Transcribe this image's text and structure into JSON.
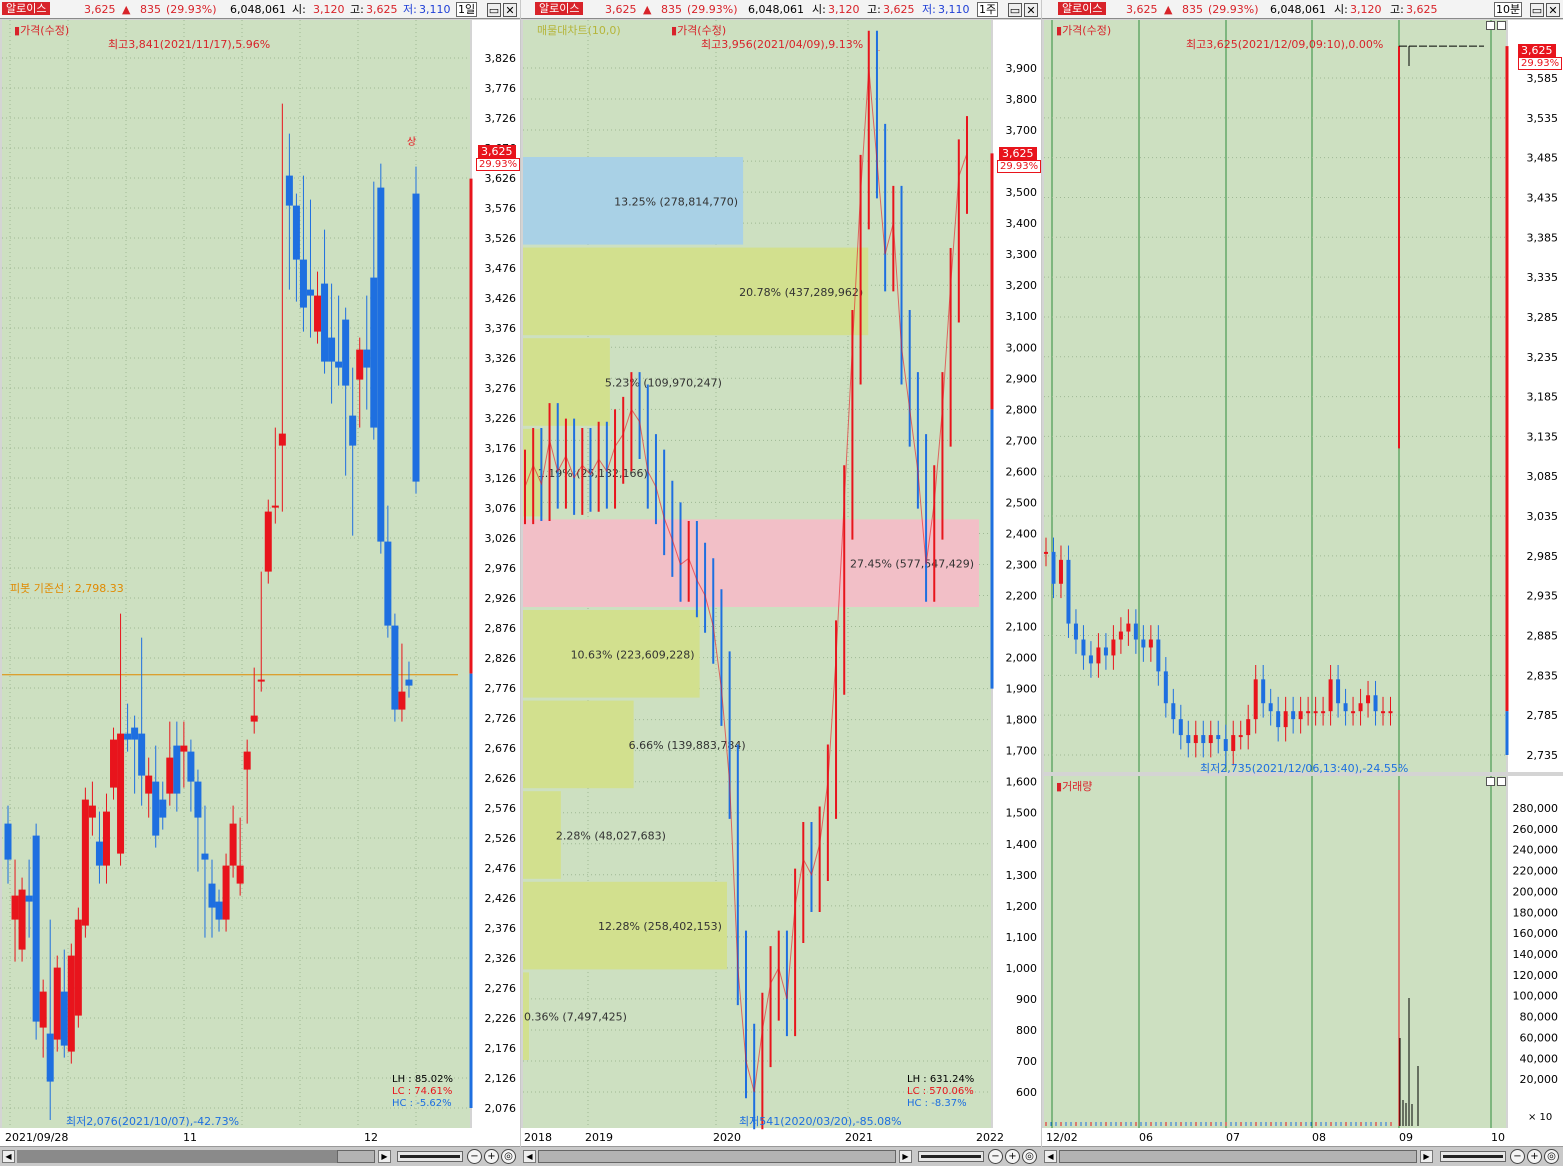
{
  "header": {
    "name": "알로이스",
    "price": "3,625",
    "change": "835",
    "pct": "(29.93%)",
    "volume": "6,048,061",
    "open_label": "시:",
    "open": "3,120",
    "high_label": "고:",
    "high": "3,625",
    "low_label": "저:",
    "low": "3,110"
  },
  "panels": {
    "daily": {
      "period": "1일",
      "legend": "가격(수정)",
      "high_annot": "최고3,841(2021/11/17),5.96%",
      "low_annot": "최저2,076(2021/10/07),-42.73%",
      "pivot": "피봇 기준선 : 2,798.33",
      "limit_up": "상",
      "price_tag": "3,625",
      "pct_tag": "29.93%",
      "lh": "LH : 85.02%",
      "lc": "LC : 74.61%",
      "hc": "HC : -5.62%",
      "x_labels": [
        "2021/09/28",
        "11",
        "12"
      ]
    },
    "weekly": {
      "period": "1주",
      "legend": "가격(수정)",
      "legend2": "매물대차트(10,0)",
      "high_annot": "최고3,956(2021/04/09),9.13%",
      "low_annot": "최저541(2020/03/20),-85.08%",
      "price_tag": "3,625",
      "pct_tag": "29.93%",
      "lh": "LH : 631.24%",
      "lc": "LC : 570.06%",
      "hc": "HC : -8.37%",
      "x_labels": [
        "2018",
        "2019",
        "2020",
        "2021",
        "2022"
      ]
    },
    "min10": {
      "period": "10분",
      "legend": "가격(수정)",
      "high_annot": "최고3,625(2021/12/09,09:10),0.00%",
      "low_annot": "최저2,735(2021/12/06,13:40),-24.55%",
      "price_tag": "3,625",
      "pct_tag": "29.93%",
      "vol_legend": "거래량",
      "vol_unit": "× 10",
      "x_labels": [
        "12/02",
        "06",
        "07",
        "08",
        "09",
        "10"
      ]
    }
  },
  "colors": {
    "up": "#e8141c",
    "down": "#1e6fe0",
    "plot_bg": "#cde0c1",
    "pivot": "#e08a00"
  },
  "chart_data": [
    {
      "type": "candlestick",
      "title": "가격(수정) 1일",
      "ylim": [
        2050,
        3900
      ],
      "y_ticks": [
        3826,
        3776,
        3726,
        3676,
        3626,
        3576,
        3526,
        3476,
        3426,
        3376,
        3326,
        3276,
        3226,
        3176,
        3126,
        3076,
        3026,
        2976,
        2926,
        2876,
        2826,
        2776,
        2726,
        2676,
        2626,
        2576,
        2526,
        2476,
        2426,
        2376,
        2326,
        2276,
        2226,
        2176,
        2126,
        2076
      ],
      "x_labels": [
        "2021/09/28",
        "11",
        "12"
      ],
      "ohlc": [
        [
          2550,
          2560,
          2470,
          2490
        ],
        [
          2390,
          2470,
          2340,
          2430
        ],
        [
          2340,
          2440,
          2340,
          2440
        ],
        [
          2430,
          2470,
          2380,
          2420
        ],
        [
          2530,
          2530,
          2210,
          2220
        ],
        [
          2210,
          2270,
          2180,
          2270
        ],
        [
          2200,
          2370,
          2076,
          2120
        ],
        [
          2190,
          2300,
          2190,
          2310
        ],
        [
          2270,
          2320,
          2180,
          2180
        ],
        [
          2170,
          2330,
          2170,
          2330
        ],
        [
          2230,
          2390,
          2230,
          2390
        ],
        [
          2380,
          2590,
          2380,
          2590
        ],
        [
          2560,
          2600,
          2550,
          2580
        ],
        [
          2520,
          2550,
          2470,
          2480
        ],
        [
          2480,
          2580,
          2470,
          2570
        ],
        [
          2610,
          2680,
          2610,
          2690
        ],
        [
          2500,
          2880,
          2500,
          2700
        ],
        [
          2700,
          2730,
          2690,
          2690
        ],
        [
          2710,
          2620,
          2680,
          2690
        ],
        [
          2700,
          2840,
          2600,
          2630
        ],
        [
          2600,
          2640,
          2580,
          2630
        ],
        [
          2620,
          2660,
          2530,
          2530
        ],
        [
          2590,
          2600,
          2560,
          2560
        ],
        [
          2600,
          2700,
          2600,
          2660
        ],
        [
          2680,
          2700,
          2590,
          2600
        ],
        [
          2670,
          2700,
          2630,
          2680
        ],
        [
          2670,
          2650,
          2590,
          2620
        ],
        [
          2620,
          2620,
          2490,
          2560
        ],
        [
          2500,
          2560,
          2380,
          2490
        ],
        [
          2450,
          2470,
          2380,
          2410
        ],
        [
          2420,
          2410,
          2400,
          2390
        ],
        [
          2390,
          2460,
          2390,
          2480
        ],
        [
          2480,
          2560,
          2480,
          2550
        ],
        [
          2450,
          2540,
          2470,
          2480
        ],
        [
          2640,
          2670,
          2570,
          2670
        ],
        [
          2720,
          2790,
          2720,
          2730
        ],
        [
          2790,
          2950,
          2790,
          2790
        ],
        [
          2970,
          3030,
          3050,
          3070
        ],
        [
          3080,
          3190,
          3070,
          3080
        ],
        [
          3180,
          3730,
          3090,
          3200
        ],
        [
          3630,
          3680,
          3460,
          3580
        ],
        [
          3580,
          3580,
          3440,
          3490
        ],
        [
          3490,
          3610,
          3390,
          3410
        ],
        [
          3440,
          3570,
          3380,
          3430
        ],
        [
          3370,
          3450,
          3380,
          3430
        ],
        [
          3450,
          3520,
          3330,
          3320
        ],
        [
          3360,
          3430,
          3270,
          3320
        ],
        [
          3320,
          3410,
          3300,
          3310
        ],
        [
          3390,
          3330,
          3150,
          3280
        ],
        [
          3230,
          3290,
          3050,
          3180
        ],
        [
          3290,
          3320,
          3230,
          3340
        ],
        [
          3340,
          3410,
          3260,
          3310
        ],
        [
          3460,
          3600,
          3280,
          3210
        ],
        [
          3610,
          3630,
          3320,
          3020
        ],
        [
          3020,
          3060,
          2880,
          2880
        ],
        [
          2880,
          2870,
          2740,
          2740
        ],
        [
          2740,
          2830,
          2760,
          2770
        ],
        [
          2790,
          2800,
          2780,
          2780
        ],
        [
          3600,
          3625,
          3120,
          3120
        ]
      ]
    },
    {
      "type": "candlestick",
      "title": "가격(수정) 1주",
      "ylim": [
        500,
        4000
      ],
      "x_labels": [
        "2018",
        "2019",
        "2020",
        "2021",
        "2022"
      ],
      "volume_profile": [
        {
          "label": "0.36% (7,497,425)",
          "pct": 0.36
        },
        {
          "label": "12.28% (258,402,153)",
          "pct": 12.28
        },
        {
          "label": "2.28% (48,027,683)",
          "pct": 2.28
        },
        {
          "label": "6.66% (139,883,784)",
          "pct": 6.66
        },
        {
          "label": "10.63% (223,609,228)",
          "pct": 10.63
        },
        {
          "label": "27.45% (577,547,429)",
          "pct": 27.45
        },
        {
          "label": "1.19% (25,132,166)",
          "pct": 1.19
        },
        {
          "label": "5.23% (109,970,247)",
          "pct": 5.23
        },
        {
          "label": "20.78% (437,289,962)",
          "pct": 20.78
        },
        {
          "label": "13.25% (278,814,770)",
          "pct": 13.25
        }
      ],
      "series_close": [
        2550,
        2620,
        2560,
        2700,
        2600,
        2650,
        2580,
        2620,
        2590,
        2640,
        2600,
        2680,
        2720,
        2800,
        2760,
        2600,
        2550,
        2450,
        2380,
        2300,
        2320,
        2250,
        2200,
        2100,
        1900,
        1600,
        1000,
        700,
        600,
        800,
        950,
        1000,
        900,
        1200,
        1350,
        1300,
        1400,
        1600,
        2000,
        2500,
        3000,
        3500,
        3900,
        3600,
        3300,
        3400,
        3000,
        2800,
        2600,
        2300,
        2500,
        2800,
        3200,
        3550,
        3625
      ],
      "y_ticks": [
        3900,
        3800,
        3700,
        3600,
        3500,
        3400,
        3300,
        3200,
        3100,
        3000,
        2900,
        2800,
        2700,
        2600,
        2500,
        2400,
        2300,
        2200,
        2100,
        2000,
        1900,
        1800,
        1700,
        1600,
        1500,
        1400,
        1300,
        1200,
        1100,
        1000,
        900,
        800,
        700,
        600
      ]
    },
    {
      "type": "candlestick",
      "title": "가격(수정) 10분",
      "ylim": [
        2710,
        3660
      ],
      "x_labels": [
        "12/02",
        "06",
        "07",
        "08",
        "09",
        "10"
      ],
      "y_ticks": [
        3585,
        3535,
        3485,
        3435,
        3385,
        3335,
        3285,
        3235,
        3185,
        3135,
        3085,
        3035,
        2985,
        2935,
        2885,
        2835,
        2785,
        2735
      ],
      "series_close": [
        2990,
        2950,
        2980,
        2900,
        2880,
        2860,
        2850,
        2870,
        2860,
        2880,
        2890,
        2900,
        2880,
        2870,
        2880,
        2840,
        2800,
        2780,
        2760,
        2750,
        2760,
        2750,
        2760,
        2755,
        2740,
        2760,
        2760,
        2780,
        2830,
        2800,
        2790,
        2770,
        2790,
        2780,
        2790,
        2790,
        2790,
        2790,
        2830,
        2800,
        2790,
        2790,
        2800,
        2810,
        2790,
        2790,
        2790,
        3625
      ],
      "volume_ticks": [
        280000,
        260000,
        240000,
        220000,
        200000,
        180000,
        160000,
        140000,
        120000,
        100000,
        80000,
        60000,
        40000,
        20000
      ]
    }
  ]
}
